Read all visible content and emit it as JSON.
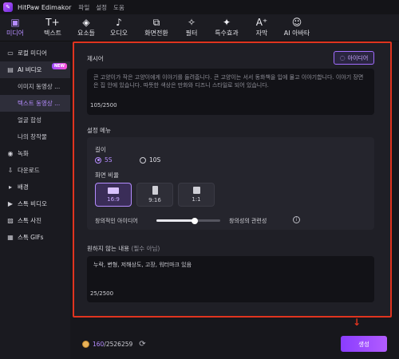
{
  "titlebar": {
    "app_name": "HitPaw Edimakor",
    "logo_icon": "app-logo-icon",
    "menu": [
      "파일",
      "설정",
      "도움"
    ]
  },
  "toolbar": {
    "items": [
      {
        "label": "미디어",
        "icon": "media-icon",
        "active": true
      },
      {
        "label": "텍스트",
        "icon": "text-icon"
      },
      {
        "label": "요소들",
        "icon": "elements-icon"
      },
      {
        "label": "오디오",
        "icon": "audio-icon"
      },
      {
        "label": "화면전환",
        "icon": "transition-icon"
      },
      {
        "label": "필터",
        "icon": "filter-icon"
      },
      {
        "label": "특수효과",
        "icon": "effects-icon"
      },
      {
        "label": "자막",
        "icon": "subtitle-icon"
      },
      {
        "label": "AI 아바타",
        "icon": "avatar-icon"
      }
    ]
  },
  "sidebar": {
    "items": [
      {
        "label": "로컬 미디어",
        "icon": "folder-icon"
      },
      {
        "label": "AI 비디오",
        "icon": "ai-video-icon",
        "badge": "NEW"
      },
      {
        "label": "이미지 동영상 ...",
        "sub": true
      },
      {
        "label": "텍스트 동영상 ...",
        "sub": true,
        "active": true
      },
      {
        "label": "얼굴 합성",
        "sub": true
      },
      {
        "label": "나의 창작물",
        "sub": true
      },
      {
        "label": "녹화",
        "icon": "record-icon"
      },
      {
        "label": "다운로드",
        "icon": "download-icon"
      },
      {
        "label": "배경",
        "icon": "background-icon"
      },
      {
        "label": "스톡 비디오",
        "icon": "stock-video-icon"
      },
      {
        "label": "스톡 사진",
        "icon": "stock-photo-icon"
      },
      {
        "label": "스톡 GIFs",
        "icon": "gif-icon"
      }
    ]
  },
  "prompt": {
    "label": "제시어",
    "idea_button": "아이디어",
    "text": "큰 고양이가 작은 고양이에게 이야기를 들려줍니다. 큰 고양이는 서서 동화책을 입에 물고 이야기합니다. 이야기 장면은 집 안에 있습니다. 따뜻한 색상은 만화와 디즈니 스타일로 되어 있습니다.",
    "counter": "105/2500"
  },
  "settings": {
    "menu_label": "설정 메뉴",
    "length_label": "길이",
    "length_options": [
      {
        "label": "5S",
        "selected": true
      },
      {
        "label": "10S",
        "selected": false
      }
    ],
    "ratio_label": "화면 비율",
    "ratios": [
      {
        "label": "16:9",
        "selected": true
      },
      {
        "label": "9:16",
        "selected": false
      },
      {
        "label": "1:1",
        "selected": false
      }
    ],
    "slider": {
      "left_label": "창의적인 아이디어",
      "right_label": "창의성의 관련성",
      "value": 0.6
    }
  },
  "negative": {
    "label": "원하지 않는 내용",
    "optional": "(필수 아님)",
    "text": "누락, 변형, 저해상도, 고장, 워터마크 있음",
    "counter": "25/2500"
  },
  "footer": {
    "credits_used": "160",
    "credits_total": "/2526259",
    "generate_button": "생성"
  },
  "colors": {
    "accent": "#b58cff",
    "highlight_border": "#e0341f",
    "button": "#8a3dff"
  }
}
